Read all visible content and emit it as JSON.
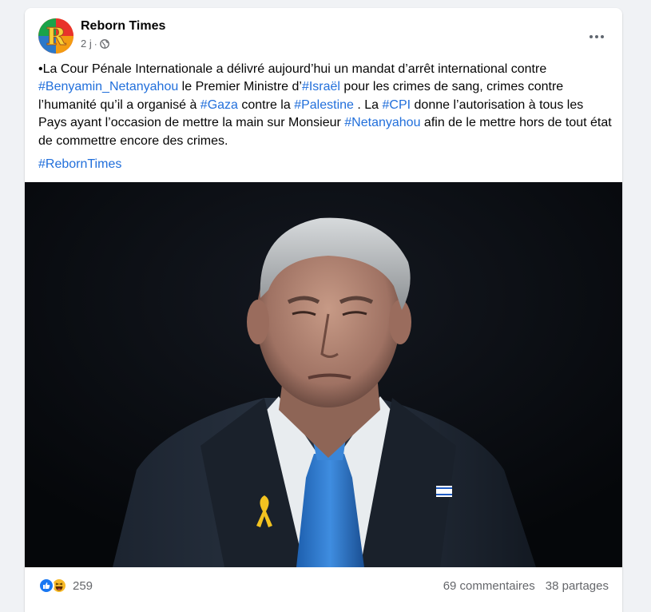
{
  "post": {
    "page_name": "Reborn Times",
    "time": "2 j",
    "separator": "·",
    "privacy_icon": "globe-icon",
    "menu_icon": "more-horizontal-icon",
    "text": {
      "p1": "•La Cour Pénale Internationale a délivré aujourd’hui un mandat d’arrêt international contre ",
      "tag1": "#Benyamin_Netanyahou",
      "p2": " le Premier Ministre d’",
      "tag2": "#Israël",
      "p3": " pour les crimes de sang, crimes contre l’humanité qu’il a organisé à ",
      "tag3": "#Gaza",
      "p4": " contre la ",
      "tag4": "#Palestine",
      "p5": " . La ",
      "tag5": "#CPI",
      "p6": " donne l’autorisation à tous les Pays ayant l’occasion de mettre la main sur Monsieur ",
      "tag6": "#Netanyahou",
      "p7": " afin de le mettre hors de tout état de commettre encore des crimes."
    },
    "hashtag_line": "#RebornTimes"
  },
  "footer": {
    "reaction_icons": [
      "like-icon",
      "haha-icon"
    ],
    "reaction_count": "259",
    "comments": "69 commentaires",
    "shares": "38 partages"
  },
  "colors": {
    "link": "#216fdb",
    "secondary_text": "#65676b",
    "like": "#1877f2",
    "haha": "#f7b928",
    "photo_bg": "#07090c"
  }
}
